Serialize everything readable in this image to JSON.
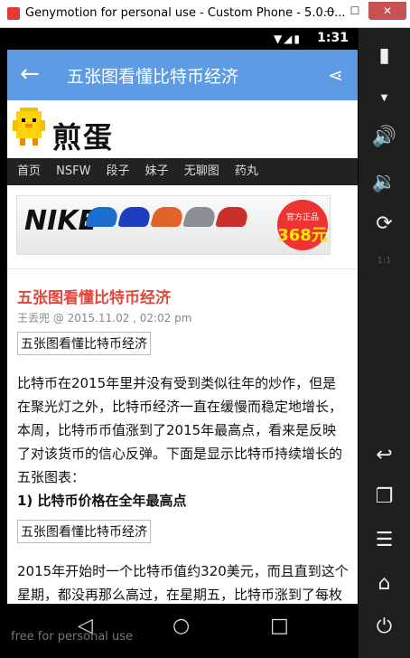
{
  "window": {
    "title": "Genymotion for personal use - Custom Phone - 5.0.0..."
  },
  "status": {
    "time": "1:31"
  },
  "appbar": {
    "title": "五张图看懂比特币经济"
  },
  "site": {
    "logo": "煎蛋"
  },
  "nav": [
    "首页",
    "NSFW",
    "段子",
    "妹子",
    "无聊图",
    "药丸"
  ],
  "ad": {
    "brand": "NIKE",
    "badge_top": "官方正品",
    "badge_price": "368元"
  },
  "article": {
    "title": "五张图看懂比特币经济",
    "meta": "王丢兜 @ 2015.11.02 , 02:02 pm",
    "img1": "五张图看懂比特币经济",
    "para1": "比特币在2015年里并没有受到类似往年的炒作，但是在聚光灯之外，比特币经济一直在缓慢而稳定地增长，本周，比特币币值涨到了2015年最高点，看来是反映了对该货币的信心反弹。下面是显示比特币持续增长的五张图表：",
    "h1": "1) 比特币价格在全年最高点",
    "img2": "五张图看懂比特币经济",
    "para2": "2015年开始时一个比特币值约320美元，而且直到这个星期，都没再那么高过，在星期五，比特币涨到了每枚"
  },
  "watermark": "free for personal use"
}
